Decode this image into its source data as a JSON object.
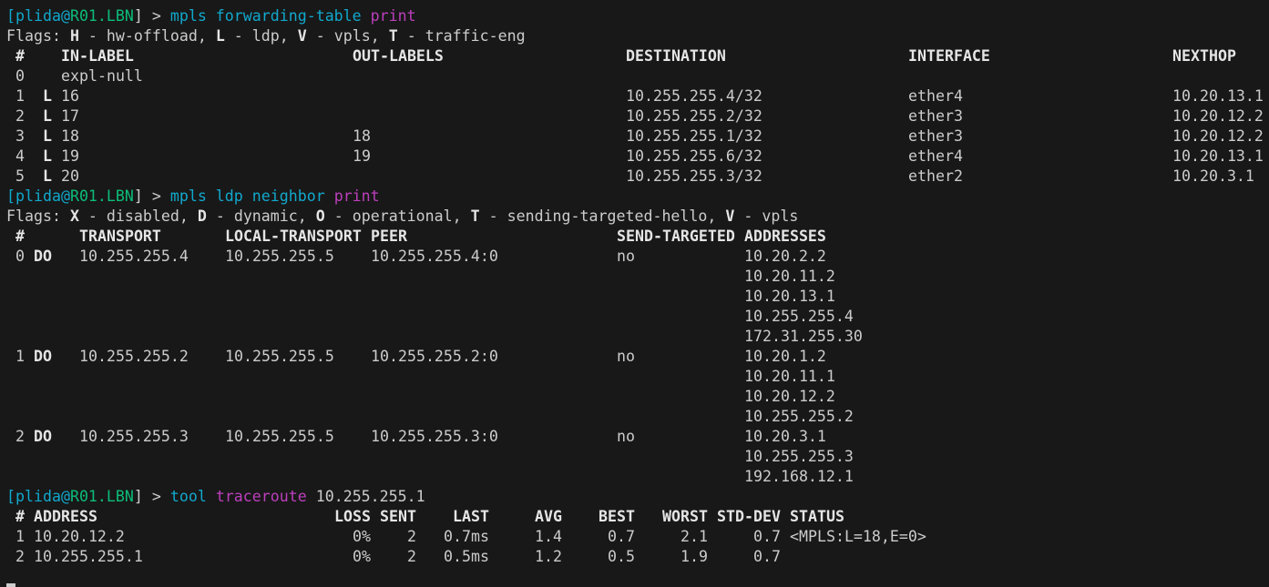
{
  "prompt": {
    "user": "plida",
    "host": "R01.LBN"
  },
  "cmd1": {
    "cmd": "mpls forwarding-table",
    "verb": "print"
  },
  "fwd": {
    "flags": [
      [
        "H",
        "hw-offload"
      ],
      [
        "L",
        "ldp"
      ],
      [
        "V",
        "vpls"
      ],
      [
        "T",
        "traffic-eng"
      ]
    ],
    "headers": [
      "#",
      "IN-LABEL",
      "OUT-LABELS",
      "DESTINATION",
      "INTERFACE",
      "NEXTHOP"
    ],
    "rows": [
      [
        "0",
        "",
        "expl-null",
        "",
        "",
        "",
        ""
      ],
      [
        "1",
        "L",
        "16",
        "",
        "10.255.255.4/32",
        "ether4",
        "10.20.13.1"
      ],
      [
        "2",
        "L",
        "17",
        "",
        "10.255.255.2/32",
        "ether3",
        "10.20.12.2"
      ],
      [
        "3",
        "L",
        "18",
        "18",
        "10.255.255.1/32",
        "ether3",
        "10.20.12.2"
      ],
      [
        "4",
        "L",
        "19",
        "19",
        "10.255.255.6/32",
        "ether4",
        "10.20.13.1"
      ],
      [
        "5",
        "L",
        "20",
        "",
        "10.255.255.3/32",
        "ether2",
        "10.20.3.1"
      ]
    ]
  },
  "cmd2": {
    "cmd": "mpls ldp neighbor",
    "verb": "print"
  },
  "ldp": {
    "flags": [
      [
        "X",
        "disabled"
      ],
      [
        "D",
        "dynamic"
      ],
      [
        "O",
        "operational"
      ],
      [
        "T",
        "sending-targeted-hello"
      ],
      [
        "V",
        "vpls"
      ]
    ],
    "headers": [
      "#",
      "TRANSPORT",
      "LOCAL-TRANSPORT",
      "PEER",
      "SEND-TARGETED",
      "ADDRESSES"
    ],
    "rows": [
      {
        "n": "0",
        "flags": "DO",
        "transport": "10.255.255.4",
        "local": "10.255.255.5",
        "peer": "10.255.255.4:0",
        "send": "no",
        "addresses": [
          "10.20.2.2",
          "10.20.11.2",
          "10.20.13.1",
          "10.255.255.4",
          "172.31.255.30"
        ]
      },
      {
        "n": "1",
        "flags": "DO",
        "transport": "10.255.255.2",
        "local": "10.255.255.5",
        "peer": "10.255.255.2:0",
        "send": "no",
        "addresses": [
          "10.20.1.2",
          "10.20.11.1",
          "10.20.12.2",
          "10.255.255.2"
        ]
      },
      {
        "n": "2",
        "flags": "DO",
        "transport": "10.255.255.3",
        "local": "10.255.255.5",
        "peer": "10.255.255.3:0",
        "send": "no",
        "addresses": [
          "10.20.3.1",
          "10.255.255.3",
          "192.168.12.1"
        ]
      }
    ]
  },
  "cmd3": {
    "cmd": "tool",
    "verb": "traceroute",
    "arg": "10.255.255.1"
  },
  "trace": {
    "headers": [
      "#",
      "ADDRESS",
      "LOSS",
      "SENT",
      "LAST",
      "AVG",
      "BEST",
      "WORST",
      "STD-DEV",
      "STATUS"
    ],
    "rows": [
      [
        "1",
        "10.20.12.2",
        "0%",
        "2",
        "0.7ms",
        "1.4",
        "0.7",
        "2.1",
        "0.7",
        "<MPLS:L=18,E=0>"
      ],
      [
        "2",
        "10.255.255.1",
        "0%",
        "2",
        "0.5ms",
        "1.2",
        "0.5",
        "1.9",
        "0.7",
        ""
      ]
    ]
  }
}
